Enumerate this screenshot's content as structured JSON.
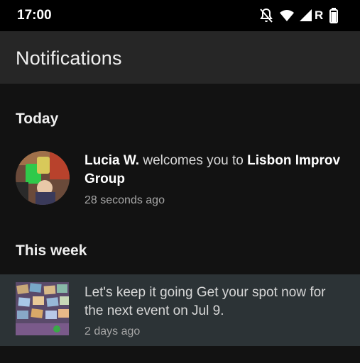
{
  "status_bar": {
    "time": "17:00",
    "icons": [
      "bell-off-icon",
      "wifi-icon",
      "cell-signal-icon",
      "battery-icon"
    ],
    "roaming_label": "R"
  },
  "app_bar": {
    "title": "Notifications"
  },
  "sections": [
    {
      "header": "Today",
      "items": [
        {
          "actor": "Lucia W.",
          "message_mid": " welcomes you to ",
          "group": "Lisbon Improv Group",
          "time": "28 seconds ago"
        }
      ]
    },
    {
      "header": "This week",
      "items": [
        {
          "message": "Let's keep it going Get your spot now for the next event on Jul 9.",
          "time": "2 days ago"
        }
      ]
    }
  ],
  "colors": {
    "background": "#121212",
    "status_bar": "#000000",
    "app_bar": "#262626",
    "highlight_row": "#2c3336"
  }
}
